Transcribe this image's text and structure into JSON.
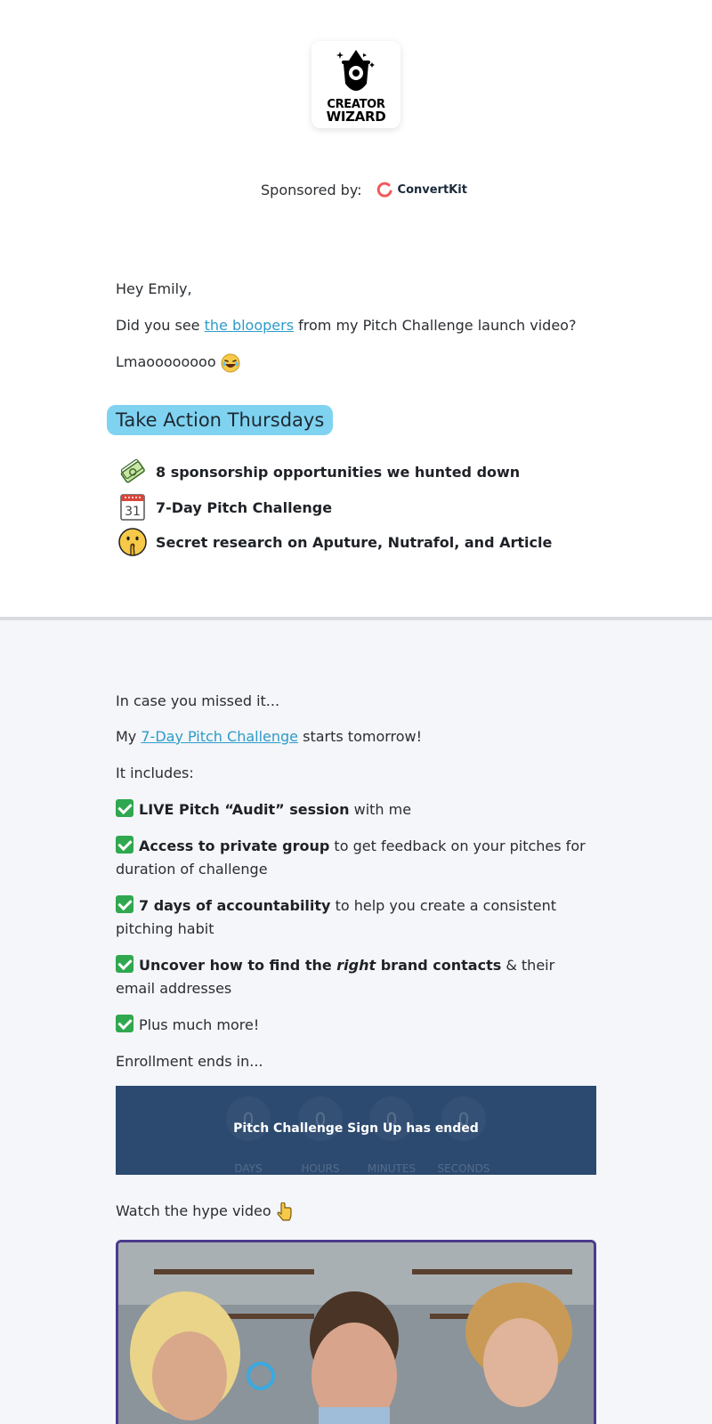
{
  "brand": {
    "logo_line1": "CREATOR",
    "logo_line2": "WIZARD"
  },
  "sponsor": {
    "label": "Sponsored by:",
    "name": "ConvertKit",
    "accent": "#f05a5a"
  },
  "intro": {
    "greeting": "Hey Emily,",
    "line2_before": "Did you see ",
    "line2_link": "the bloopers",
    "line2_after": " from my Pitch Challenge launch video?",
    "line3": "Lmaoooooooo"
  },
  "take_action": {
    "title": "Take Action Thursdays",
    "items": [
      {
        "icon": "money-icon",
        "label": "8 sponsorship opportunities we hunted down"
      },
      {
        "icon": "calendar-icon",
        "label": "7-Day Pitch Challenge",
        "calendar_day": "31"
      },
      {
        "icon": "shush-face-icon",
        "label": "Secret research on Aputure, Nutrafol, and Article"
      }
    ]
  },
  "challenge": {
    "missed": "In case you missed it...",
    "starts_before": "My ",
    "starts_link": "7-Day Pitch Challenge",
    "starts_after": " starts tomorrow!",
    "includes": "It includes:",
    "features": [
      {
        "bold": "LIVE Pitch “Audit” session",
        "rest": " with me"
      },
      {
        "bold": "Access to private group",
        "rest": " to get feedback on your pitches for duration of challenge"
      },
      {
        "bold": "7 days of accountability",
        "rest": " to help you create a consistent pitching habit"
      },
      {
        "bold_a": "Uncover how to find the ",
        "bold_i": "right",
        "bold_b": " brand contacts",
        "rest": " & their email addresses"
      },
      {
        "plain": "Plus much more!"
      }
    ],
    "enrollment": "Enrollment ends in..."
  },
  "countdown": {
    "message": "Pitch Challenge Sign Up has ended",
    "days": "0",
    "hours": "0",
    "minutes": "0",
    "seconds": "0",
    "days_label": "DAYS",
    "hours_label": "HOURS",
    "minutes_label": "MINUTES",
    "seconds_label": "SECONDS",
    "bg": "#2c4a70"
  },
  "video": {
    "caption": "Watch the hype video"
  },
  "colors": {
    "link": "#2e9bc9",
    "highlight": "#7fd3f0",
    "check": "#2fa84f"
  }
}
